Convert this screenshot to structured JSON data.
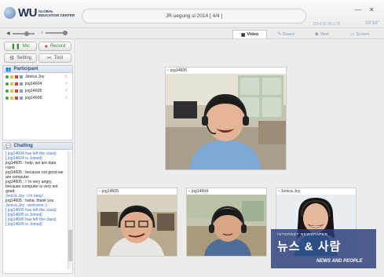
{
  "app": {
    "brand_short": "WU",
    "brand_line1": "GLOBAL",
    "brand_line2": "EDUCATION CENTER",
    "session_title": "JR-segung sl 2014 [ 4/4 ]",
    "minimize": "—",
    "close": "✕"
  },
  "toolbar": {
    "tabs": [
      {
        "label": "Video",
        "icon": "video-icon",
        "active": true
      },
      {
        "label": "Board",
        "icon": "board-icon",
        "active": false
      },
      {
        "label": "Web",
        "icon": "web-icon",
        "active": false
      },
      {
        "label": "Screen",
        "icon": "screen-icon",
        "active": false
      }
    ],
    "lts_label": "2014.02.06 LTS",
    "elapsed_time": "29'18\""
  },
  "controls": {
    "mic_label": "Mic",
    "record_label": "Record",
    "setting_label": "Setting",
    "tool_label": "Tool"
  },
  "participants": {
    "heading": "Participant",
    "items": [
      {
        "name": "Jenica Joy",
        "avatar": "teacher-avatar-icon"
      },
      {
        "name": "jog14604",
        "avatar": "student-avatar-icon"
      },
      {
        "name": "jog14605",
        "avatar": "student-avatar-icon"
      },
      {
        "name": "jog14606",
        "avatar": "student-avatar-icon"
      }
    ]
  },
  "chat": {
    "heading": "Chatting",
    "lines": [
      {
        "text": "[ jog14604 has left the class]",
        "kind": "sys"
      },
      {
        "text": "[ jog14604 is Joined]",
        "kind": "sys"
      },
      {
        "text": "jog14605 : help, we are data room",
        "kind": "msg"
      },
      {
        "text": "jog14605 : because not good we are computer",
        "kind": "msg"
      },
      {
        "text": "jog14605 : I 'm very angry, because computer is very not good",
        "kind": "msg"
      },
      {
        "text": "Jenica Joy : it's okay!",
        "kind": "sys"
      },
      {
        "text": "jog14605 : haha. thank you",
        "kind": "msg"
      },
      {
        "text": "Jenica Joy : welcome :)",
        "kind": "sys"
      },
      {
        "text": "[ jog14605 has left the class]",
        "kind": "sys"
      },
      {
        "text": "[ jog14605 is Joined]",
        "kind": "sys"
      },
      {
        "text": "[ jog14606 has left the class]",
        "kind": "sys"
      },
      {
        "text": "[ jog14606 is Joined]",
        "kind": "sys"
      }
    ]
  },
  "videos": {
    "main": {
      "label": "jog14606"
    },
    "thumbs": [
      {
        "label": "jog14605"
      },
      {
        "label": "jog14604"
      },
      {
        "label": "Jenica Joy"
      }
    ]
  },
  "watermark": {
    "top": "INTERNET NEWSPAPER",
    "main": "뉴스 & 사람",
    "sub": "NEWS AND PEOPLE"
  },
  "colors": {
    "accent_blue": "#3b6db5",
    "mic_green": "#3a8a3a",
    "record_red": "#d03a2a"
  }
}
